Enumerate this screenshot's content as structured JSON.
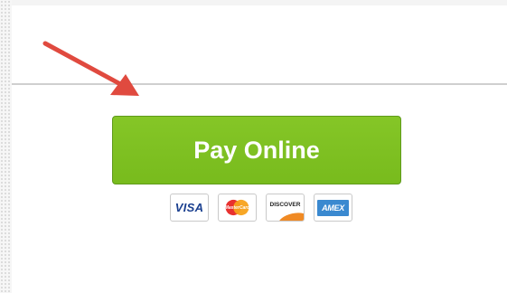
{
  "payment": {
    "button_label": "Pay Online",
    "button_color": "#7fbf22",
    "arrow_color": "#e04a3f"
  },
  "cards": {
    "visa": "VISA",
    "mastercard": "MasterCard",
    "discover": "DISCOVER",
    "amex": "AMEX"
  },
  "icons": {
    "arrow": "arrow-pointing-icon",
    "visa": "visa-logo-icon",
    "mastercard": "mastercard-logo-icon",
    "discover": "discover-logo-icon",
    "amex": "amex-logo-icon"
  }
}
